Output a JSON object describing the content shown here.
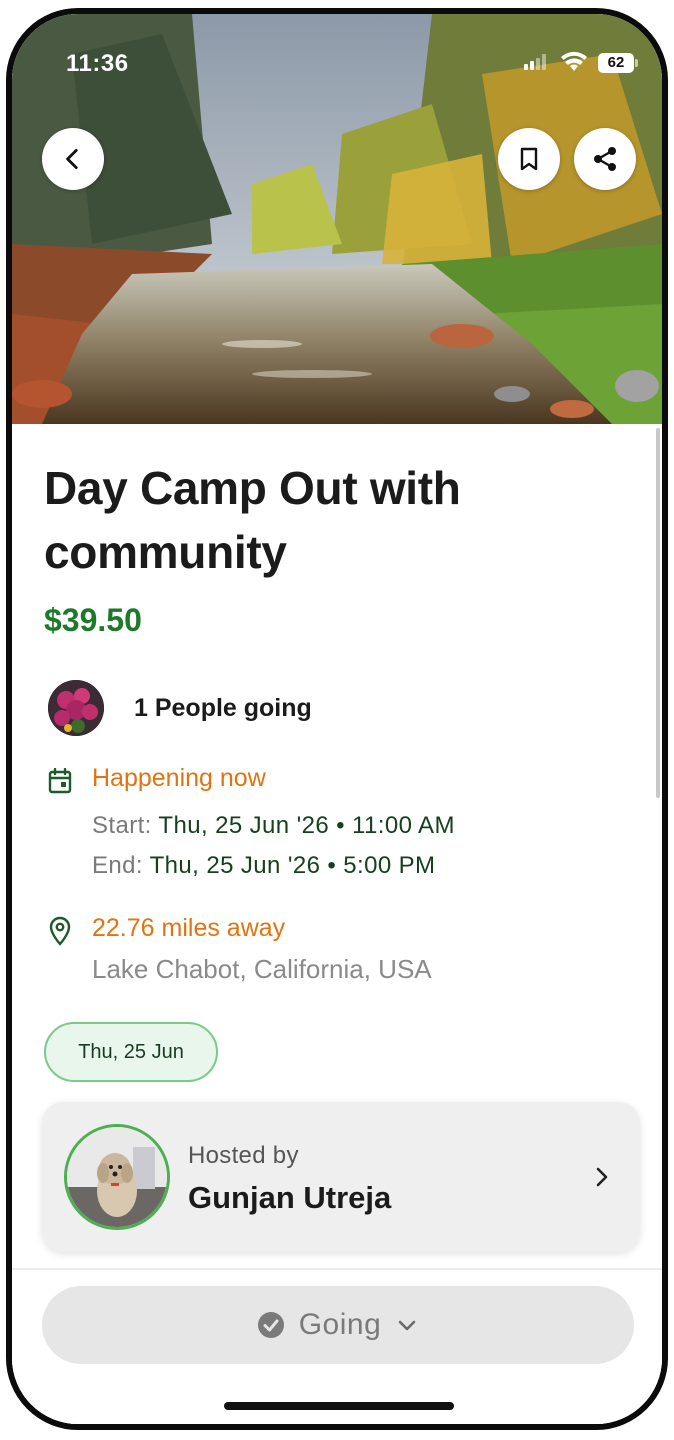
{
  "status_bar": {
    "time": "11:36",
    "battery": "62"
  },
  "nav": {
    "back_icon": "chevron-left-icon",
    "bookmark_icon": "bookmark-icon",
    "share_icon": "share-icon"
  },
  "event": {
    "title": "Day Camp Out with community",
    "price": "$39.50",
    "people_going": "1 People going",
    "status": "Happening now",
    "start_label": "Start:",
    "start_value": "Thu, 25 Jun '26 • 11:00 AM",
    "end_label": "End:",
    "end_value": "Thu, 25 Jun '26 • 5:00 PM",
    "distance": "22.76 miles away",
    "location": "Lake Chabot, California, USA",
    "date_chip": "Thu, 25 Jun"
  },
  "host": {
    "hosted_by_label": "Hosted by",
    "name": "Gunjan Utreja"
  },
  "action": {
    "going_label": "Going"
  },
  "colors": {
    "price_green": "#1e7a2b",
    "accent_orange": "#e07412",
    "chip_border": "#7cc98a",
    "host_ring": "#4caf50"
  }
}
